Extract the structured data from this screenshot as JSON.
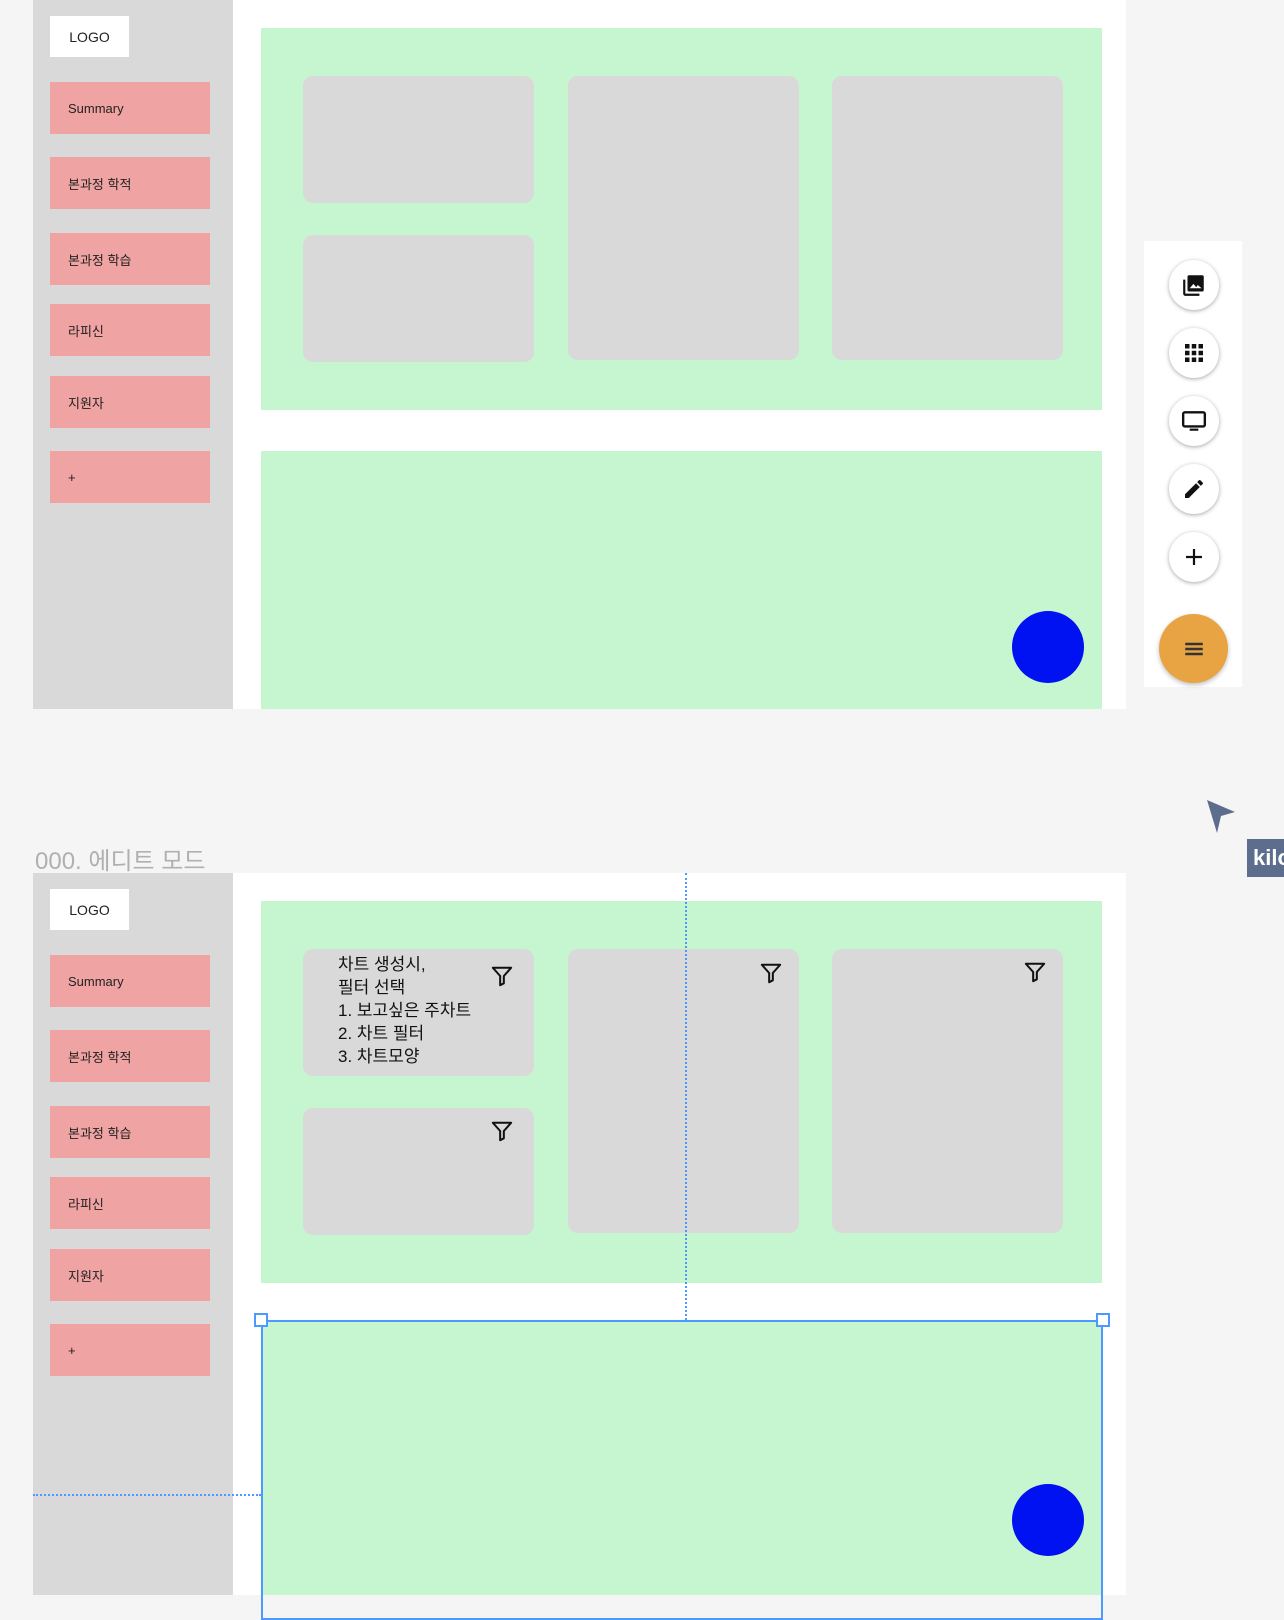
{
  "sidebar": {
    "logo": "LOGO",
    "items": [
      "Summary",
      "본과정 학적",
      "본과정 학습",
      "라피신",
      "지원자",
      "+"
    ]
  },
  "edit_section": {
    "title": "000. 에디트 모드",
    "card_note": "차트 생성시,\n필터 선택\n1. 보고싶은 주차트\n2. 차트 필터\n3. 차트모양"
  },
  "collaborator": {
    "name": "kilo"
  },
  "toolbar": {
    "icons": [
      "image-gallery-icon",
      "grid-apps-icon",
      "monitor-icon",
      "pencil-icon",
      "plus-icon",
      "menu-icon"
    ]
  },
  "colors": {
    "sidebar": "#d9d9d9",
    "nav_item": "#f0a3a3",
    "panel": "#c6f6cf",
    "card": "#d9d9d9",
    "fab": "#0012f2",
    "menu_button": "#e8a443",
    "selection": "#4c9aff"
  }
}
